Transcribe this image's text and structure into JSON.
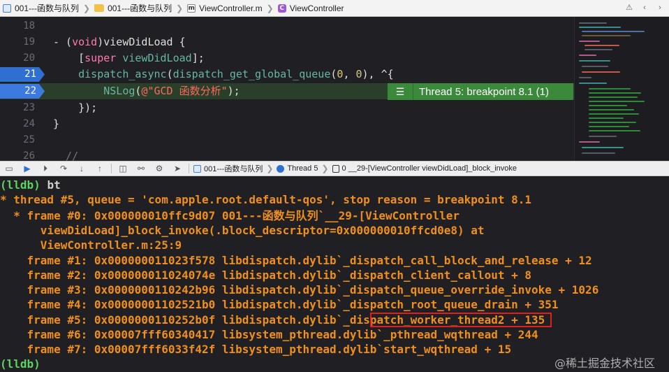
{
  "jumpbar": {
    "project": "001---函数与队列",
    "folder": "001---函数与队列",
    "file": "ViewController.m",
    "file_icon_letter": "m",
    "class": "ViewController",
    "class_icon_letter": "C"
  },
  "editor": {
    "lines": [
      {
        "no": "18"
      },
      {
        "no": "19",
        "t1": "- (",
        "t2": "void",
        "t3": ")viewDidLoad {"
      },
      {
        "no": "20",
        "t1": "    [",
        "t2": "super",
        "t3": " ",
        "t4": "viewDidLoad",
        "t5": "];"
      },
      {
        "no": "21",
        "t1": "    ",
        "t2": "dispatch_async",
        "t3": "(",
        "t4": "dispatch_get_global_queue",
        "t5": "(",
        "t6": "0",
        "t7": ", ",
        "t8": "0",
        "t9": "), ^{"
      },
      {
        "no": "22",
        "t1": "        ",
        "t2": "NSLog",
        "t3": "(",
        "t4": "@\"GCD 函数分析\"",
        "t5": ");"
      },
      {
        "no": "23",
        "t1": "    });"
      },
      {
        "no": "24",
        "t1": "}"
      },
      {
        "no": "25"
      },
      {
        "no": "26",
        "t1": "  //"
      }
    ],
    "thread_badge": "Thread 5: breakpoint 8.1 (1)"
  },
  "debugbar": {
    "crumb_project": "001---函数与队列",
    "crumb_thread": "Thread 5",
    "crumb_frame": "0 __29-[ViewController viewDidLoad]_block_invoke"
  },
  "console": {
    "prompt": "(lldb)",
    "command": "bt",
    "lines": [
      "* thread #5, queue = 'com.apple.root.default-qos', stop reason = breakpoint 8.1",
      "  * frame #0: 0x000000010ffc9d07 001---函数与队列`__29-[ViewController",
      "      viewDidLoad]_block_invoke(.block_descriptor=0x000000010ffcd0e8) at",
      "      ViewController.m:25:9",
      "    frame #1: 0x000000011023f578 libdispatch.dylib`_dispatch_call_block_and_release + 12",
      "    frame #2: 0x000000011024074e libdispatch.dylib`_dispatch_client_callout + 8",
      "    frame #3: 0x0000000110242b96 libdispatch.dylib`_dispatch_queue_override_invoke + 1026",
      "    frame #4: 0x00000001102521b0 libdispatch.dylib`_dispatch_root_queue_drain + 351",
      "    frame #5: 0x0000000110252b0f libdispatch.dylib`_dispatch_worker_thread2 + 135",
      "    frame #6: 0x00007fff60340417 libsystem_pthread.dylib`_pthread_wqthread + 244",
      "    frame #7: 0x00007fff6033f42f libsystem_pthread.dylib`start_wqthread + 15"
    ],
    "end_prompt": "(lldb)",
    "watermark": "@稀土掘金技术社区"
  },
  "colors": {
    "breakpoint": "#2f6fd1",
    "badge": "#3b8a3b",
    "console_text": "#f0901a",
    "highlight_box": "#e02020"
  }
}
